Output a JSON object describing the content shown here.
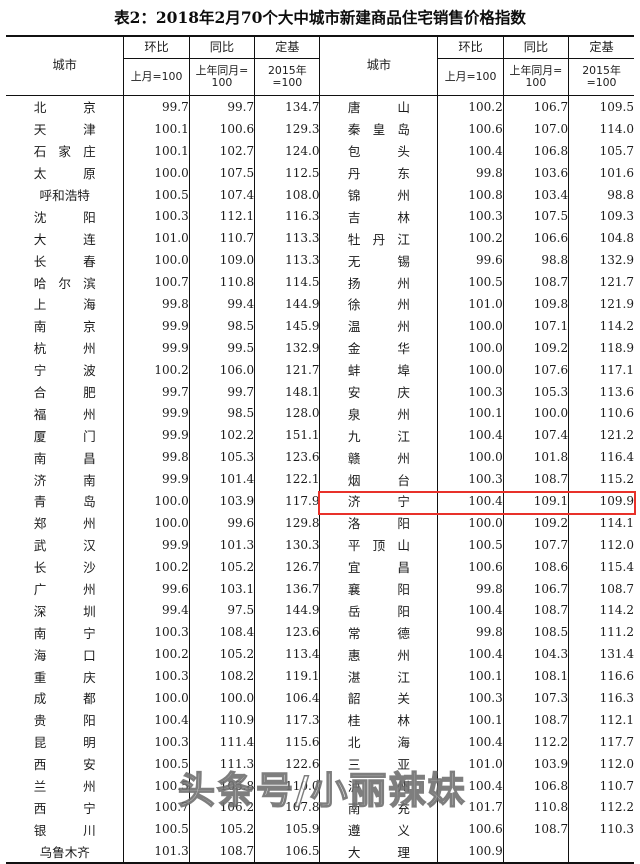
{
  "title": "表2：2018年2月70个大中城市新建商品住宅销售价格指数",
  "watermark": "头条号/小丽辣妹",
  "header": {
    "city_label": "城市",
    "groups": [
      {
        "top": "环比",
        "sub_line1": "上月=100",
        "sub_line2": ""
      },
      {
        "top": "同比",
        "sub_line1": "上年同月=",
        "sub_line2": "100"
      },
      {
        "top": "定基",
        "sub_line1": "2015年",
        "sub_line2": "=100"
      }
    ]
  },
  "highlight": {
    "city": "济宁",
    "color": "#e8312a"
  },
  "chart_data": {
    "type": "table",
    "title": "表2：2018年2月70个大中城市新建商品住宅销售价格指数",
    "columns": [
      "城市",
      "环比 上月=100",
      "同比 上年同月=100",
      "定基 2015年=100"
    ],
    "left_rows": [
      {
        "city": "北京",
        "mom": "99.7",
        "yoy": "99.7",
        "base": "134.7"
      },
      {
        "city": "天津",
        "mom": "100.1",
        "yoy": "100.6",
        "base": "129.3"
      },
      {
        "city": "石家庄",
        "mom": "100.1",
        "yoy": "102.7",
        "base": "124.0"
      },
      {
        "city": "太原",
        "mom": "100.0",
        "yoy": "107.5",
        "base": "112.5"
      },
      {
        "city": "呼和浩特",
        "mom": "100.5",
        "yoy": "107.4",
        "base": "108.0"
      },
      {
        "city": "沈阳",
        "mom": "100.3",
        "yoy": "112.1",
        "base": "116.3"
      },
      {
        "city": "大连",
        "mom": "101.0",
        "yoy": "110.7",
        "base": "113.3"
      },
      {
        "city": "长春",
        "mom": "100.0",
        "yoy": "109.0",
        "base": "113.3"
      },
      {
        "city": "哈尔滨",
        "mom": "100.7",
        "yoy": "110.8",
        "base": "114.5"
      },
      {
        "city": "上海",
        "mom": "99.8",
        "yoy": "99.4",
        "base": "144.9"
      },
      {
        "city": "南京",
        "mom": "99.9",
        "yoy": "98.5",
        "base": "145.9"
      },
      {
        "city": "杭州",
        "mom": "99.9",
        "yoy": "99.5",
        "base": "132.9"
      },
      {
        "city": "宁波",
        "mom": "100.2",
        "yoy": "106.0",
        "base": "121.7"
      },
      {
        "city": "合肥",
        "mom": "99.7",
        "yoy": "99.7",
        "base": "148.1"
      },
      {
        "city": "福州",
        "mom": "99.9",
        "yoy": "98.5",
        "base": "128.0"
      },
      {
        "city": "厦门",
        "mom": "99.9",
        "yoy": "102.2",
        "base": "151.1"
      },
      {
        "city": "南昌",
        "mom": "99.8",
        "yoy": "105.3",
        "base": "123.6"
      },
      {
        "city": "济南",
        "mom": "99.9",
        "yoy": "101.4",
        "base": "122.1"
      },
      {
        "city": "青岛",
        "mom": "100.0",
        "yoy": "103.9",
        "base": "117.9"
      },
      {
        "city": "郑州",
        "mom": "100.0",
        "yoy": "99.6",
        "base": "129.8"
      },
      {
        "city": "武汉",
        "mom": "99.9",
        "yoy": "101.3",
        "base": "130.3"
      },
      {
        "city": "长沙",
        "mom": "100.2",
        "yoy": "105.2",
        "base": "126.7"
      },
      {
        "city": "广州",
        "mom": "99.6",
        "yoy": "103.1",
        "base": "136.7"
      },
      {
        "city": "深圳",
        "mom": "99.4",
        "yoy": "97.5",
        "base": "144.9"
      },
      {
        "city": "南宁",
        "mom": "100.3",
        "yoy": "108.4",
        "base": "123.6"
      },
      {
        "city": "海口",
        "mom": "100.2",
        "yoy": "105.2",
        "base": "113.4"
      },
      {
        "city": "重庆",
        "mom": "100.3",
        "yoy": "108.2",
        "base": "119.1"
      },
      {
        "city": "成都",
        "mom": "100.0",
        "yoy": "100.0",
        "base": "106.4"
      },
      {
        "city": "贵阳",
        "mom": "100.4",
        "yoy": "110.9",
        "base": "117.3"
      },
      {
        "city": "昆明",
        "mom": "100.3",
        "yoy": "111.4",
        "base": "115.6"
      },
      {
        "city": "西安",
        "mom": "100.5",
        "yoy": "111.3",
        "base": "122.6"
      },
      {
        "city": "兰州",
        "mom": "100.5",
        "yoy": "105.8",
        "base": "110.0"
      },
      {
        "city": "西宁",
        "mom": "100.7",
        "yoy": "106.2",
        "base": "107.8"
      },
      {
        "city": "银川",
        "mom": "100.5",
        "yoy": "105.2",
        "base": "105.9"
      },
      {
        "city": "乌鲁木齐",
        "mom": "101.3",
        "yoy": "108.7",
        "base": "106.5"
      }
    ],
    "right_rows": [
      {
        "city": "唐山",
        "mom": "100.2",
        "yoy": "106.7",
        "base": "109.5"
      },
      {
        "city": "秦皇岛",
        "mom": "100.6",
        "yoy": "107.0",
        "base": "114.0"
      },
      {
        "city": "包头",
        "mom": "100.4",
        "yoy": "106.8",
        "base": "105.7"
      },
      {
        "city": "丹东",
        "mom": "99.8",
        "yoy": "103.6",
        "base": "101.6"
      },
      {
        "city": "锦州",
        "mom": "100.8",
        "yoy": "103.4",
        "base": "98.8"
      },
      {
        "city": "吉林",
        "mom": "100.3",
        "yoy": "107.5",
        "base": "109.3"
      },
      {
        "city": "牡丹江",
        "mom": "100.2",
        "yoy": "106.6",
        "base": "104.8"
      },
      {
        "city": "无锡",
        "mom": "99.6",
        "yoy": "98.8",
        "base": "132.9"
      },
      {
        "city": "扬州",
        "mom": "100.5",
        "yoy": "108.7",
        "base": "121.7"
      },
      {
        "city": "徐州",
        "mom": "101.0",
        "yoy": "109.8",
        "base": "121.9"
      },
      {
        "city": "温州",
        "mom": "100.0",
        "yoy": "107.1",
        "base": "114.2"
      },
      {
        "city": "金华",
        "mom": "100.0",
        "yoy": "109.2",
        "base": "118.9"
      },
      {
        "city": "蚌埠",
        "mom": "100.0",
        "yoy": "107.6",
        "base": "117.1"
      },
      {
        "city": "安庆",
        "mom": "100.3",
        "yoy": "105.3",
        "base": "113.6"
      },
      {
        "city": "泉州",
        "mom": "100.1",
        "yoy": "100.0",
        "base": "110.6"
      },
      {
        "city": "九江",
        "mom": "100.4",
        "yoy": "107.4",
        "base": "121.2"
      },
      {
        "city": "赣州",
        "mom": "100.0",
        "yoy": "101.8",
        "base": "116.4"
      },
      {
        "city": "烟台",
        "mom": "100.3",
        "yoy": "108.7",
        "base": "115.2"
      },
      {
        "city": "济宁",
        "mom": "100.4",
        "yoy": "109.1",
        "base": "109.9"
      },
      {
        "city": "洛阳",
        "mom": "100.0",
        "yoy": "109.2",
        "base": "114.1"
      },
      {
        "city": "平顶山",
        "mom": "100.5",
        "yoy": "107.7",
        "base": "112.0"
      },
      {
        "city": "宜昌",
        "mom": "100.6",
        "yoy": "108.6",
        "base": "115.4"
      },
      {
        "city": "襄阳",
        "mom": "99.8",
        "yoy": "106.7",
        "base": "108.7"
      },
      {
        "city": "岳阳",
        "mom": "100.4",
        "yoy": "108.7",
        "base": "114.2"
      },
      {
        "city": "常德",
        "mom": "99.8",
        "yoy": "108.5",
        "base": "111.2"
      },
      {
        "city": "惠州",
        "mom": "100.4",
        "yoy": "104.3",
        "base": "131.4"
      },
      {
        "city": "湛江",
        "mom": "100.1",
        "yoy": "108.1",
        "base": "116.6"
      },
      {
        "city": "韶关",
        "mom": "100.3",
        "yoy": "107.3",
        "base": "116.3"
      },
      {
        "city": "桂林",
        "mom": "100.1",
        "yoy": "108.7",
        "base": "112.1"
      },
      {
        "city": "北海",
        "mom": "100.4",
        "yoy": "112.2",
        "base": "117.7"
      },
      {
        "city": "三亚",
        "mom": "101.0",
        "yoy": "103.9",
        "base": "112.0"
      },
      {
        "city": "泸州",
        "mom": "100.4",
        "yoy": "106.8",
        "base": "110.7"
      },
      {
        "city": "南充",
        "mom": "101.7",
        "yoy": "110.8",
        "base": "112.2"
      },
      {
        "city": "遵义",
        "mom": "100.6",
        "yoy": "108.7",
        "base": "110.3"
      },
      {
        "city": "大理",
        "mom": "100.9",
        "yoy": "",
        "base": ""
      }
    ]
  }
}
